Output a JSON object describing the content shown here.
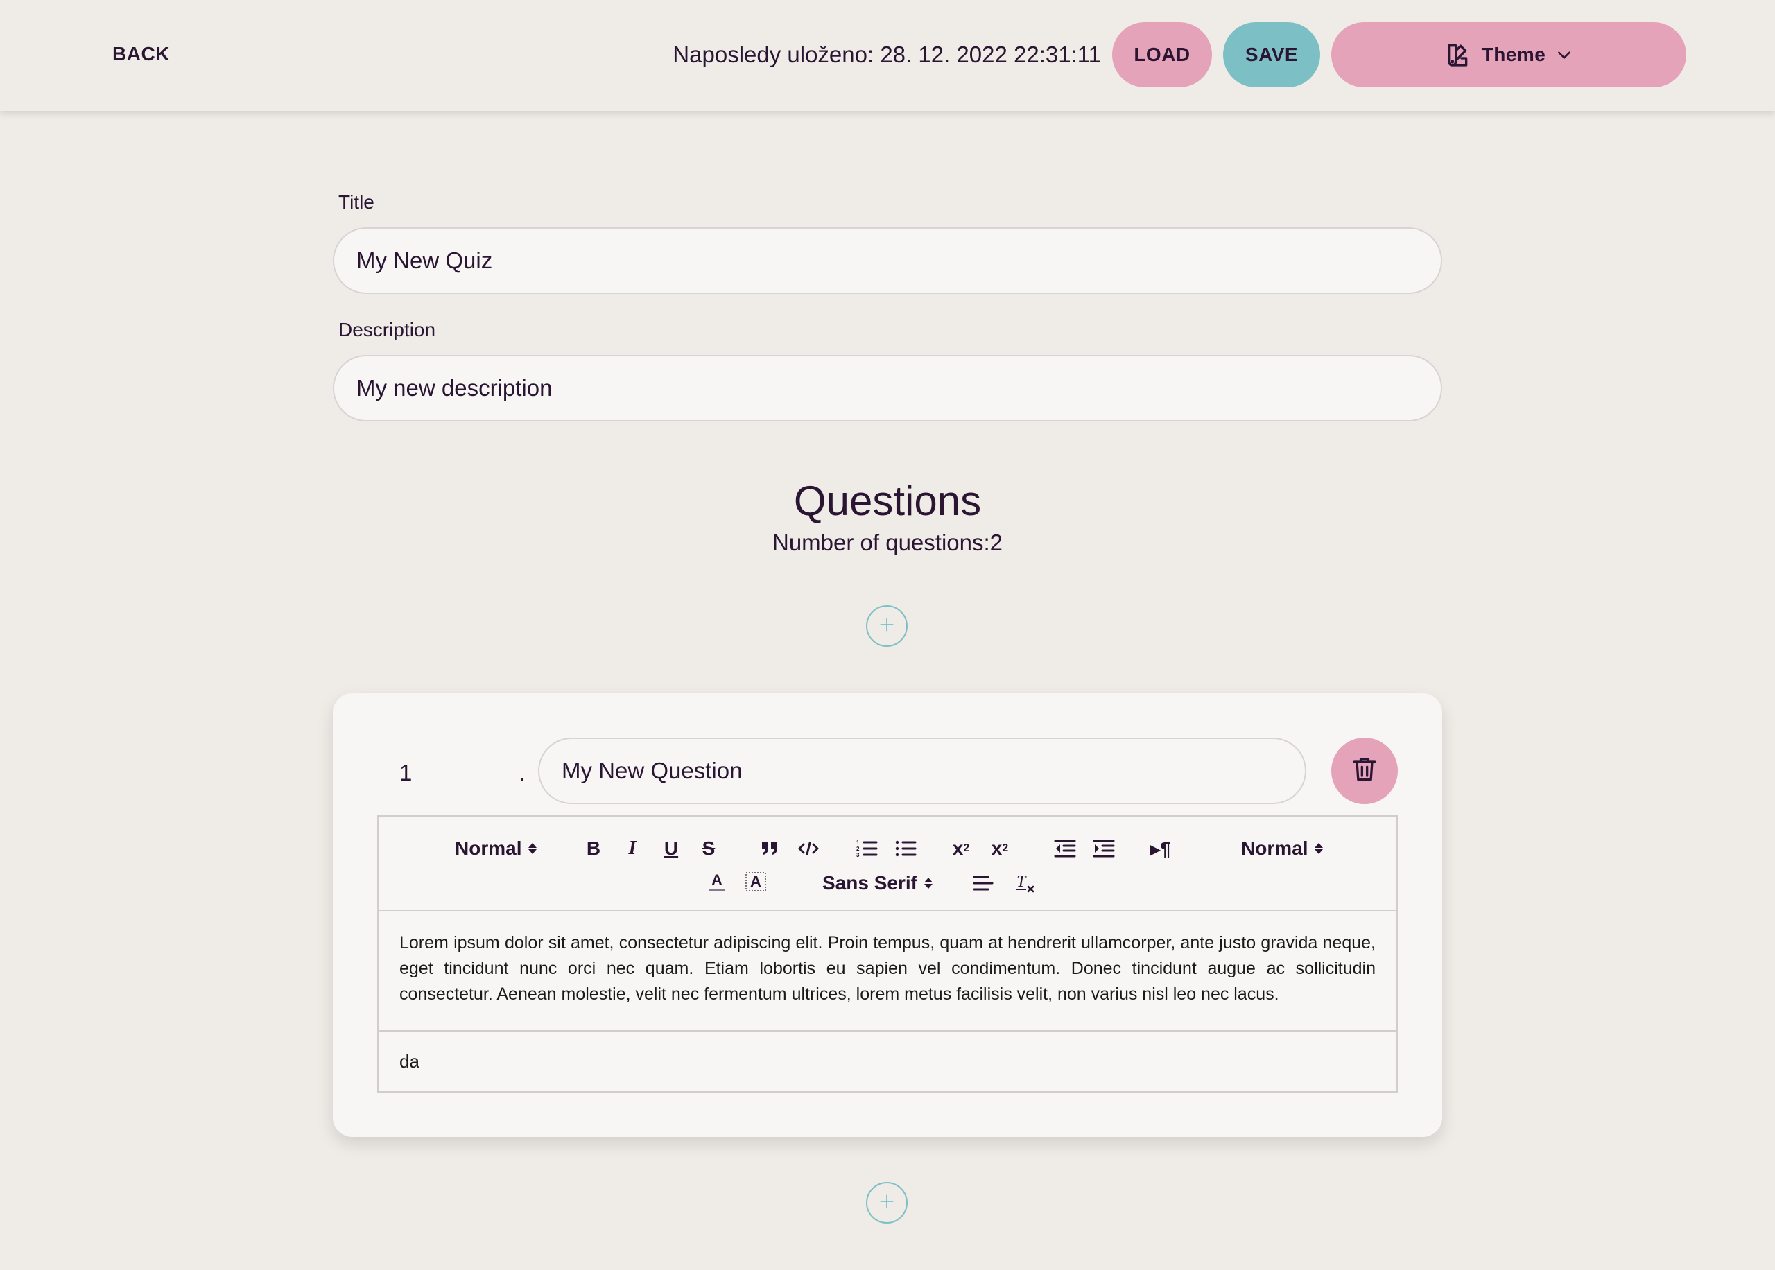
{
  "header": {
    "back_label": "BACK",
    "last_saved": "Naposledy uloženo: 28. 12. 2022 22:31:11",
    "load_label": "LOAD",
    "save_label": "SAVE",
    "theme_label": "Theme"
  },
  "form": {
    "title_label": "Title",
    "title_value": "My New Quiz",
    "description_label": "Description",
    "description_value": "My new description"
  },
  "questions": {
    "heading": "Questions",
    "count_text": "Number of questions:2",
    "items": [
      {
        "number": "1",
        "dot": ".",
        "question_value": "My New Question",
        "editor": {
          "header_select": "Normal",
          "size_select": "Normal",
          "font_select": "Sans Serif",
          "body_text": "Lorem ipsum dolor sit amet, consectetur adipiscing elit. Proin tempus, quam at hendrerit ullamcorper, ante justo gravida neque, eget tincidunt nunc orci nec quam. Etiam lobortis eu sapien vel condimentum. Donec tincidunt augue ac sollicitudin consectetur. Aenean molestie, velit nec fermentum ultrices, lorem metus facilisis velit, non varius nisl leo nec lacus."
        },
        "answer_value": "da"
      }
    ]
  },
  "colors": {
    "background": "#efebe7",
    "pink_accent": "#e5a3ba",
    "teal_accent": "#7cc0c6",
    "text": "#2a1533"
  }
}
